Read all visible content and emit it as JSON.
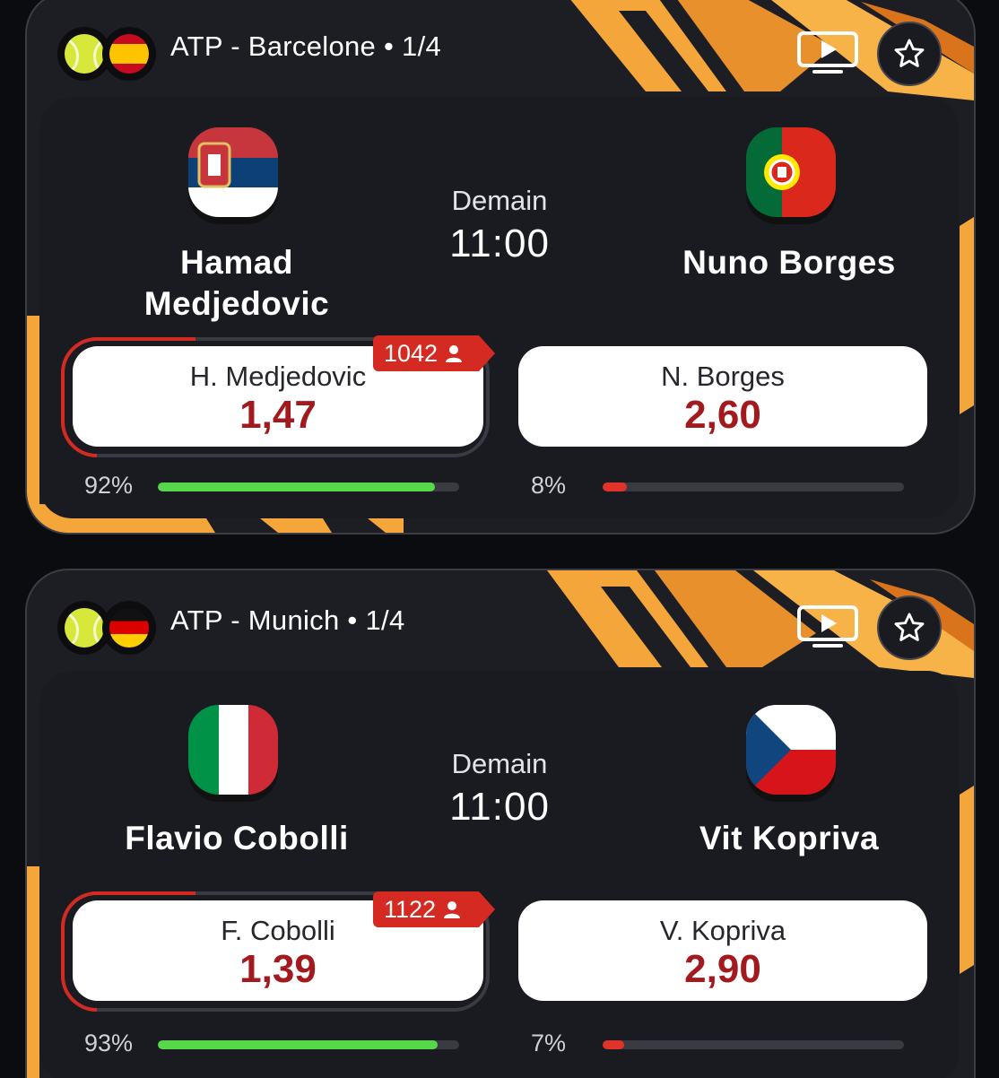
{
  "colors": {
    "background": "#0b0c10",
    "card": "#1d1e24",
    "accent_red": "#d42a22",
    "odd_red": "#a31a1e",
    "bar_green": "#56d84a",
    "bar_red": "#e0342a",
    "flame_orange": "#f5a63a"
  },
  "matches": [
    {
      "sport_icon": "tennis-ball-icon",
      "country_flag": "spain-flag-icon",
      "tournament": "ATP - Barcelone • 1/4",
      "when": "Demain",
      "time": "11:00",
      "player1": {
        "name": "Hamad Medjedovic",
        "flag": "serbia-flag-icon",
        "short": "H. Medjedovic",
        "odd": "1,47",
        "pct_label": "92%",
        "pct": 92,
        "votes": "1042"
      },
      "player2": {
        "name": "Nuno Borges",
        "flag": "portugal-flag-icon",
        "short": "N. Borges",
        "odd": "2,60",
        "pct_label": "8%",
        "pct": 8
      }
    },
    {
      "sport_icon": "tennis-ball-icon",
      "country_flag": "germany-flag-icon",
      "tournament": "ATP - Munich • 1/4",
      "when": "Demain",
      "time": "11:00",
      "player1": {
        "name": "Flavio Cobolli",
        "flag": "italy-flag-icon",
        "short": "F. Cobolli",
        "odd": "1,39",
        "pct_label": "93%",
        "pct": 93,
        "votes": "1122"
      },
      "player2": {
        "name": "Vit Kopriva",
        "flag": "czech-flag-icon",
        "short": "V. Kopriva",
        "odd": "2,90",
        "pct_label": "7%",
        "pct": 7
      }
    }
  ]
}
